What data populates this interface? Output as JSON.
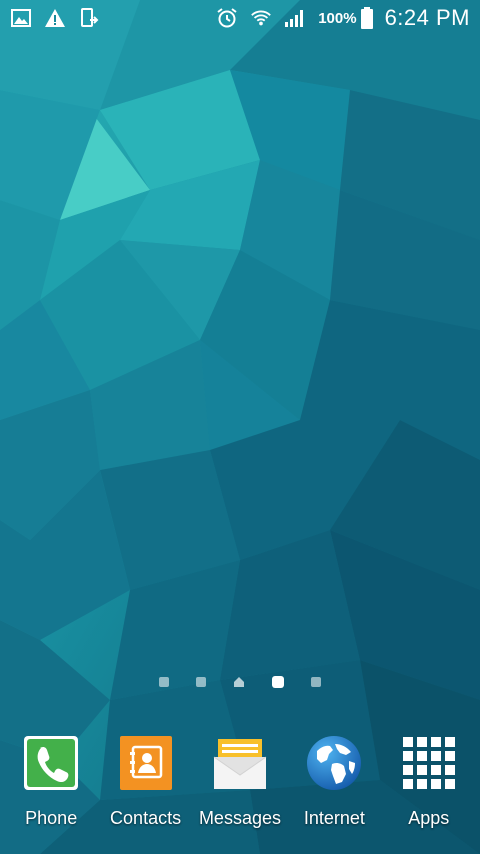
{
  "status_bar": {
    "left_icons": [
      "gallery-icon",
      "warning-icon",
      "screen-mirroring-icon"
    ],
    "right_icons": [
      "alarm-icon",
      "wifi-icon",
      "signal-icon",
      "battery-icon"
    ],
    "battery_percent": "100%",
    "time": "6:24 PM"
  },
  "home": {
    "page_count": 5,
    "home_page_index": 2,
    "active_page_index": 3
  },
  "dock": [
    {
      "label": "Phone",
      "icon": "phone-icon",
      "color": "#4caf50"
    },
    {
      "label": "Contacts",
      "icon": "contacts-icon",
      "color": "#f39222"
    },
    {
      "label": "Messages",
      "icon": "messages-icon",
      "color": "#f8c02a"
    },
    {
      "label": "Internet",
      "icon": "globe-icon",
      "color": "#1e73c8"
    },
    {
      "label": "Apps",
      "icon": "apps-grid-icon",
      "color": "#ffffff"
    }
  ],
  "colors": {
    "wallpaper_light": "#2ec4c4",
    "wallpaper_mid": "#1a94a6",
    "wallpaper_dark": "#0e5f74"
  }
}
